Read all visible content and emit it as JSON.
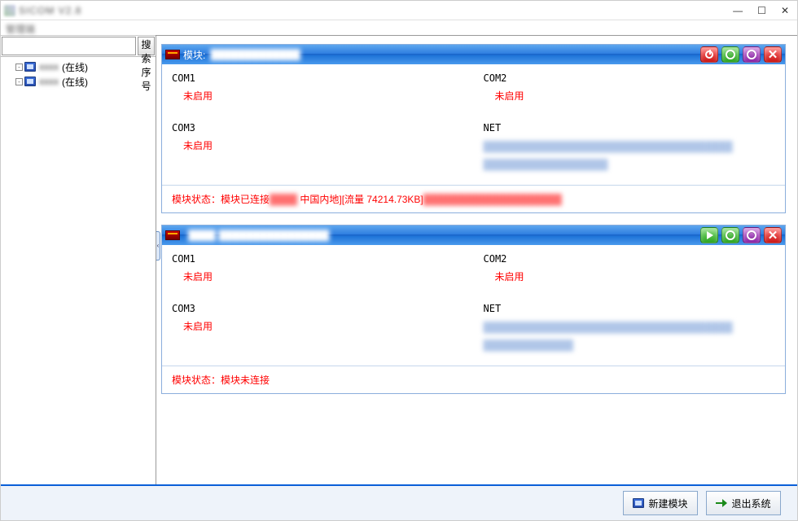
{
  "window": {
    "title_blurred": "SICOM V2.8",
    "subtitle_blurred": "管理端",
    "minimize": "—",
    "maximize": "☐",
    "close": "✕"
  },
  "sidebar": {
    "search_placeholder": "",
    "search_button": "搜索序号",
    "items": [
      {
        "left_blurred": "xxxx",
        "right_clear": "(在线)"
      },
      {
        "left_blurred": "xxxx",
        "right_clear": "(在线)"
      }
    ]
  },
  "modules": [
    {
      "header_prefix": "模块:",
      "header_blur": "█████████████",
      "header_icons": [
        "power",
        "gear",
        "gear2",
        "close"
      ],
      "cells": {
        "com1": {
          "title": "COM1",
          "value": "未启用"
        },
        "com2": {
          "title": "COM2",
          "value": "未启用"
        },
        "com3": {
          "title": "COM3",
          "value": "未启用"
        },
        "net": {
          "title": "NET",
          "value_blur": "████████████████████████████████████\n██████████████████"
        }
      },
      "footer": {
        "prefix": "模块状态：模块已连接",
        "mid_blur": "████",
        "mid_clear": " 中国内地][流量 74214.73KB]",
        "end_blur": "████████████████████"
      }
    },
    {
      "header_prefix": "",
      "header_blur": "████ ████████████████",
      "header_icons": [
        "play",
        "gear",
        "gear2",
        "close"
      ],
      "cells": {
        "com1": {
          "title": "COM1",
          "value": "未启用"
        },
        "com2": {
          "title": "COM2",
          "value": "未启用"
        },
        "com3": {
          "title": "COM3",
          "value": "未启用"
        },
        "net": {
          "title": "NET",
          "value_blur": "████████████████████████████████████\n█████████████"
        }
      },
      "footer": {
        "prefix": "模块状态：模块未连接",
        "mid_blur": "",
        "mid_clear": "",
        "end_blur": ""
      }
    }
  ],
  "bottombar": {
    "new_module": "新建模块",
    "exit": "退出系统"
  }
}
